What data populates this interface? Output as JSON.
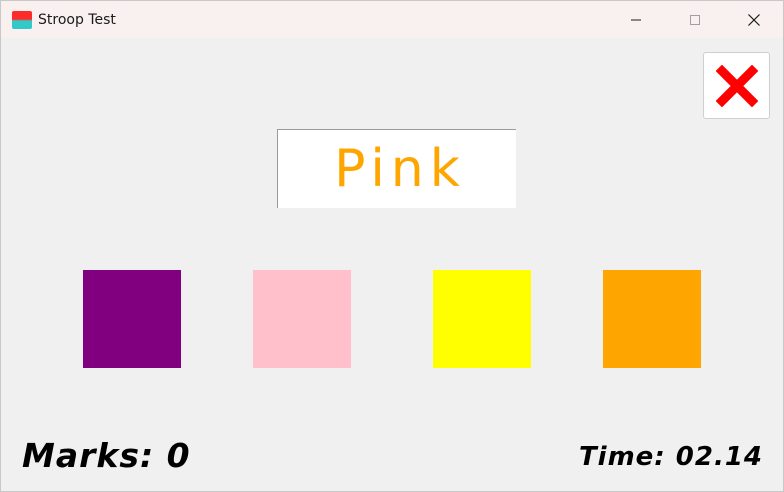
{
  "window": {
    "title": "Stroop Test"
  },
  "title_controls": {
    "minimize_icon": "minimize-icon",
    "maximize_icon": "maximize-icon",
    "close_icon": "close-icon"
  },
  "exit_button": {
    "icon": "red-x-icon",
    "color": "#ff0000"
  },
  "stimulus": {
    "word": "Pink",
    "ink_color": "#ffa500"
  },
  "swatches": [
    {
      "color": "#800080"
    },
    {
      "color": "#ffc0cb"
    },
    {
      "color": "#ffff00"
    },
    {
      "color": "#ffa500"
    }
  ],
  "score": {
    "marks_text": "Marks: 0",
    "time_text": "Time: 02.14"
  }
}
